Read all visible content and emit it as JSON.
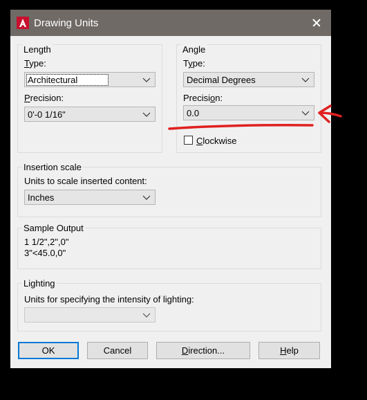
{
  "window": {
    "title": "Drawing Units",
    "close_icon": "close-icon",
    "app_icon": "autocad-icon"
  },
  "length": {
    "legend": "Length",
    "type_label": "Type:",
    "type_mnemonic": "T",
    "type_rest": "ype:",
    "type_value": "Architectural",
    "precision_mnemonic": "P",
    "precision_rest": "recision:",
    "precision_value": "0'-0 1/16\""
  },
  "angle": {
    "legend": "Angle",
    "type_pre": "T",
    "type_mnemonic": "y",
    "type_rest": "pe:",
    "type_value": "Decimal Degrees",
    "precision_pre": "Precisi",
    "precision_mnemonic": "o",
    "precision_rest": "n:",
    "precision_value": "0.0",
    "clockwise_mnemonic": "C",
    "clockwise_rest": "lockwise",
    "clockwise_checked": false
  },
  "insertion": {
    "legend": "Insertion scale",
    "label": "Units to scale inserted content:",
    "value": "Inches"
  },
  "sample": {
    "legend": "Sample Output",
    "line1": "1 1/2\",2\",0\"",
    "line2": "3\"<45.0,0\""
  },
  "lighting": {
    "legend": "Lighting",
    "label": "Units for specifying the intensity of lighting:",
    "value": ""
  },
  "buttons": {
    "ok": "OK",
    "cancel": "Cancel",
    "direction_mnemonic": "D",
    "direction_rest": "irection...",
    "help_mnemonic": "H",
    "help_rest": "elp"
  },
  "annotation_color": "#e02020"
}
